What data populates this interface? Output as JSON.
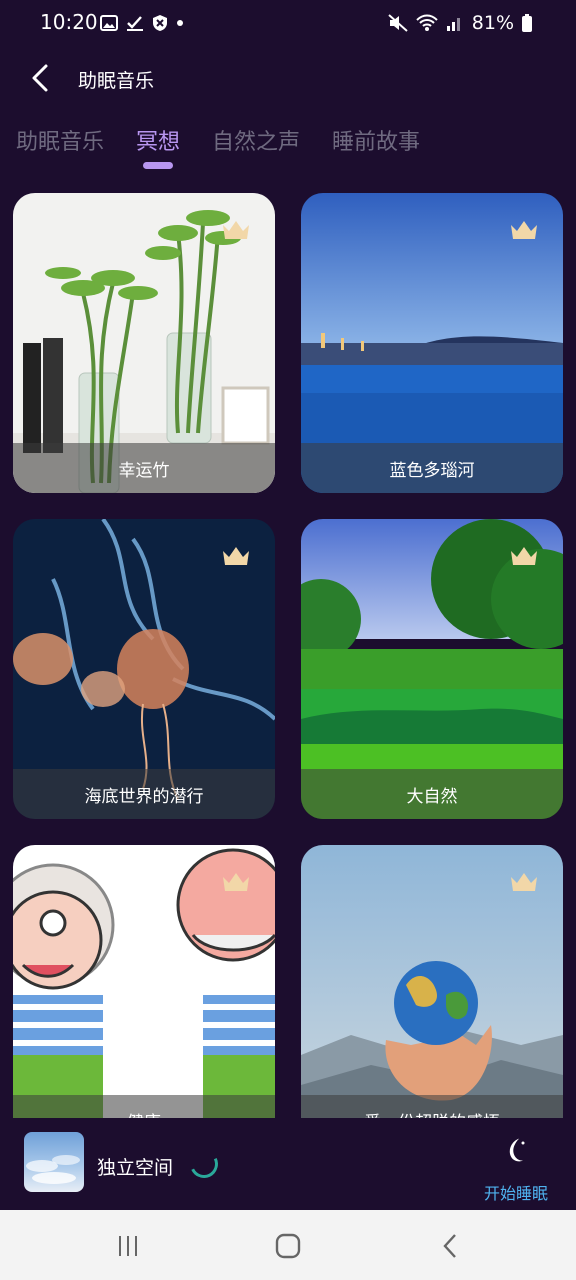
{
  "status_bar": {
    "time": "10:20",
    "battery": "81%"
  },
  "header": {
    "title": "助眠音乐",
    "back_icon": "chevron-left-icon"
  },
  "tabs": [
    {
      "label": "助眠音乐",
      "active": false
    },
    {
      "label": "冥想",
      "active": true
    },
    {
      "label": "自然之声",
      "active": false
    },
    {
      "label": "睡前故事",
      "active": false
    }
  ],
  "cards": [
    {
      "label": "幸运竹",
      "premium": true
    },
    {
      "label": "蓝色多瑙河",
      "premium": true
    },
    {
      "label": "海底世界的潜行",
      "premium": true
    },
    {
      "label": "大自然",
      "premium": true
    },
    {
      "label": "健康",
      "premium": true
    },
    {
      "label": "爱，份超脱的感悟",
      "premium": true
    }
  ],
  "player": {
    "title": "独立空间",
    "action_label": "开始睡眠",
    "action_icon": "moon-icon"
  },
  "colors": {
    "background": "#1c0d2e",
    "tab_active": "#b896f0",
    "tab_inactive": "#6f6a80",
    "crown": "#f2d7a8",
    "action": "#4fb3f0"
  }
}
